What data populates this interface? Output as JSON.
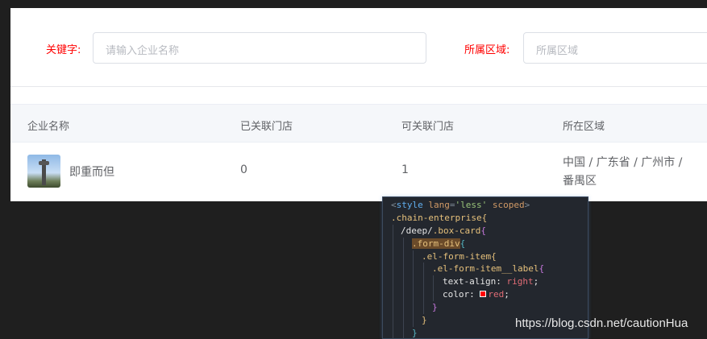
{
  "form": {
    "keyword_label": "关键字:",
    "keyword_placeholder": "请输入企业名称",
    "region_label": "所属区域:",
    "region_placeholder": "所属区域"
  },
  "table": {
    "headers": [
      "企业名称",
      "已关联门店",
      "可关联门店",
      "所在区域"
    ],
    "rows": [
      {
        "name": "即重而但",
        "linked": "0",
        "available": "1",
        "region": "中国 / 广东省 / 广州市 / 番禺区"
      }
    ]
  },
  "code": {
    "lines": [
      "<style lang='less' scoped>",
      ".chain-enterprise{",
      "/deep/.box-card{",
      ".form-div{",
      ".el-form-item{",
      ".el-form-item__label{",
      "text-align: right;",
      "color: red;",
      "}",
      "}",
      "}"
    ]
  },
  "colors": {
    "label_red": "#ff0000",
    "code_bg": "#23272e"
  },
  "watermark": "https://blog.csdn.net/cautionHua"
}
